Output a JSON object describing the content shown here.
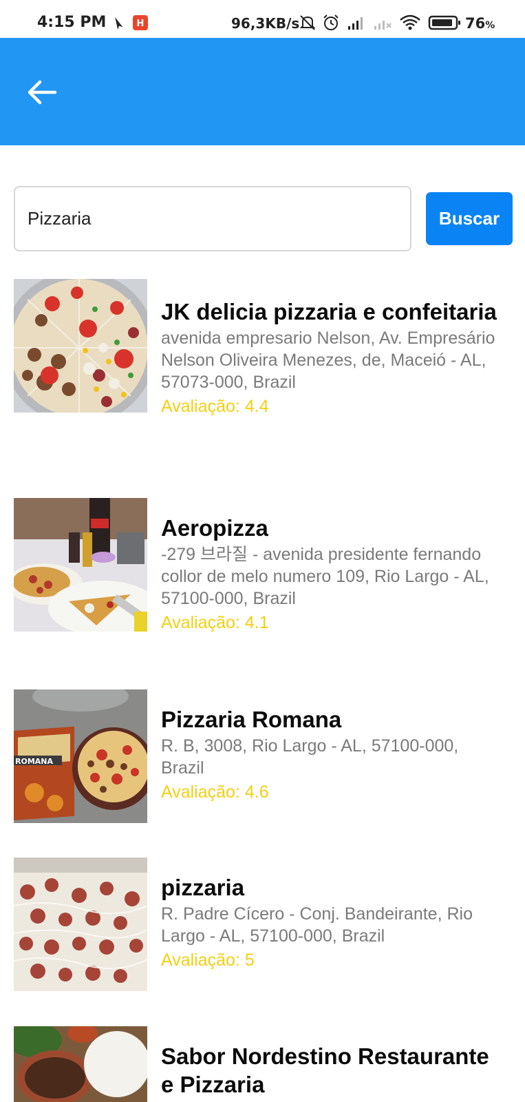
{
  "status_bar": {
    "time": "4:15 PM",
    "network_speed": "96,3KB/s",
    "battery_percent": "76",
    "battery_unit": "%",
    "icons": [
      "navigation-icon",
      "app-notification-icon",
      "mute-icon",
      "alarm-icon",
      "signal-icon",
      "signal-no-service-icon",
      "wifi-icon",
      "battery-icon"
    ]
  },
  "app_bar": {
    "back_icon": "arrow-left-icon",
    "color": "#2196f3"
  },
  "search": {
    "value": "Pizzaria",
    "button_label": "Buscar",
    "button_color": "#0a84f5"
  },
  "rating_color": "#f4cf12",
  "results": [
    {
      "name": "JK delicia pizzaria e confeitaria",
      "address": "avenida empresario Nelson, Av. Empresário Nelson Oliveira Menezes, de, Maceió - AL, 57073-000, Brazil",
      "rating": "Avaliação: 4.4"
    },
    {
      "name": "Aeropizza",
      "address": "-279 브라질 - avenida presidente fernando collor de melo numero 109, Rio Largo - AL, 57100-000, Brazil",
      "rating": "Avaliação: 4.1"
    },
    {
      "name": "Pizzaria Romana",
      "address": "R. B, 3008, Rio Largo - AL, 57100-000, Brazil",
      "rating": "Avaliação: 4.6",
      "image_text": "ROMANA"
    },
    {
      "name": "pizzaria",
      "address": "R. Padre Cícero - Conj. Bandeirante, Rio Largo - AL, 57100-000, Brazil",
      "rating": "Avaliação: 5"
    },
    {
      "name": "Sabor Nordestino Restaurante e Pizzaria",
      "address": "",
      "rating": ""
    }
  ]
}
